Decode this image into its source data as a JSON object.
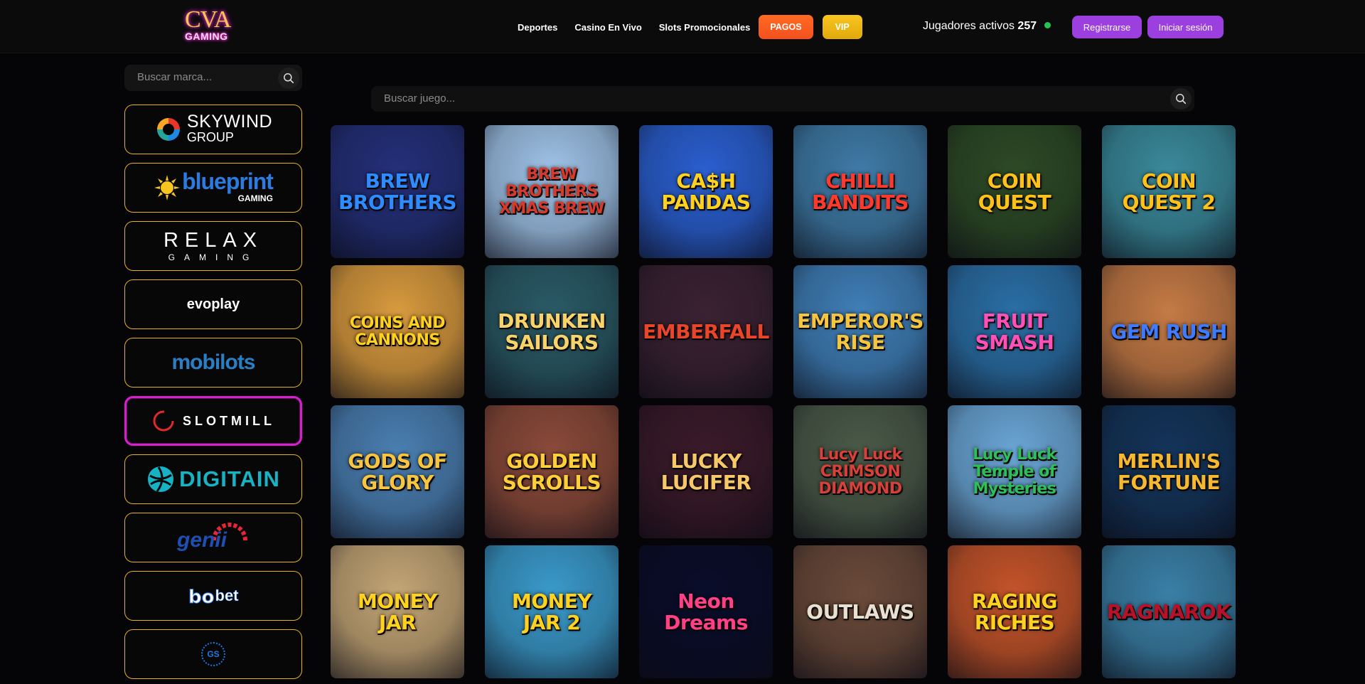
{
  "header": {
    "logo_top": "CVA",
    "logo_bottom": "GAMING",
    "nav": [
      "Deportes",
      "Casino En Vivo",
      "Slots Promocionales"
    ],
    "pagos": "PAGOS",
    "vip": "VIP",
    "players_label": "Jugadores activos",
    "players_count": "257",
    "register": "Registrarse",
    "login": "Iniciar sesión"
  },
  "brand_search": {
    "placeholder": "Buscar marca..."
  },
  "game_search": {
    "placeholder": "Buscar juego..."
  },
  "providers": [
    {
      "id": "skywind",
      "line1": "SKYWIND",
      "line2": "GROUP"
    },
    {
      "id": "blueprint",
      "line1": "blueprint",
      "line2": "GAMING"
    },
    {
      "id": "relax",
      "line1": "RELAX",
      "line2": "GAMING"
    },
    {
      "id": "evoplay",
      "line1": "evoplay"
    },
    {
      "id": "mobilots",
      "line1": "mobilots"
    },
    {
      "id": "slotmill",
      "line1": "SLOTMILL",
      "active": true
    },
    {
      "id": "digitain",
      "line1": "DIGITAIN"
    },
    {
      "id": "genii",
      "line1": "genii"
    },
    {
      "id": "bbet",
      "line1": "bet"
    },
    {
      "id": "gs",
      "line1": "GS"
    }
  ],
  "games": [
    {
      "title": "BREW BROTHERS",
      "bg": "#24307a",
      "color": "#2f8cff"
    },
    {
      "title": "BREW BROTHERS XMAS BREW",
      "bg": "#9fc3e8",
      "color": "#d63a2c"
    },
    {
      "title": "CA$H PANDAS",
      "bg": "#2a5fd0",
      "color": "#ffd21f"
    },
    {
      "title": "CHILLI BANDITS",
      "bg": "#3f7ba7",
      "color": "#ff3a2d"
    },
    {
      "title": "COIN QUEST",
      "bg": "#2d4a26",
      "color": "#ffc21a"
    },
    {
      "title": "COIN QUEST 2",
      "bg": "#3a8a9c",
      "color": "#ffc21a"
    },
    {
      "title": "COINS AND CANNONS",
      "bg": "#d89a3e",
      "color": "#ffd21f"
    },
    {
      "title": "DRUNKEN SAILORS",
      "bg": "#2a5a66",
      "color": "#f8d36a"
    },
    {
      "title": "EMBERFALL",
      "bg": "#3a2233",
      "color": "#e9452a"
    },
    {
      "title": "EMPEROR'S RISE",
      "bg": "#3f7fb8",
      "color": "#f6c540"
    },
    {
      "title": "FRUIT SMASH",
      "bg": "#2a6fa6",
      "color": "#ff4fb8"
    },
    {
      "title": "GEM RUSH",
      "bg": "#c47a45",
      "color": "#3e7bff"
    },
    {
      "title": "GODS OF GLORY",
      "bg": "#4a7fb2",
      "color": "#f8c540"
    },
    {
      "title": "GOLDEN SCROLLS",
      "bg": "#8a4a3a",
      "color": "#ffcf3a"
    },
    {
      "title": "LUCKY LUCIFER",
      "bg": "#3a1a2a",
      "color": "#f6c86a"
    },
    {
      "title": "Lucy Luck CRIMSON DIAMOND",
      "bg": "#4a5a48",
      "color": "#d6413a"
    },
    {
      "title": "Lucy Luck Temple of Mysteries",
      "bg": "#6aa6d6",
      "color": "#2fbf5a"
    },
    {
      "title": "MERLIN'S FORTUNE",
      "bg": "#14345a",
      "color": "#f6b830"
    },
    {
      "title": "MONEY JAR",
      "bg": "#c4a676",
      "color": "#ffd21f"
    },
    {
      "title": "MONEY JAR 2",
      "bg": "#3a9acb",
      "color": "#ffd21f"
    },
    {
      "title": "Neon Dreams",
      "bg": "#0a0d2a",
      "color": "#ff3f87"
    },
    {
      "title": "OUTLAWS",
      "bg": "#6a4a3a",
      "color": "#e8e0d0"
    },
    {
      "title": "RAGING RICHES",
      "bg": "#c4542a",
      "color": "#ffd21f"
    },
    {
      "title": "RAGNAROK",
      "bg": "#3a7fa6",
      "color": "#b8122a"
    }
  ]
}
